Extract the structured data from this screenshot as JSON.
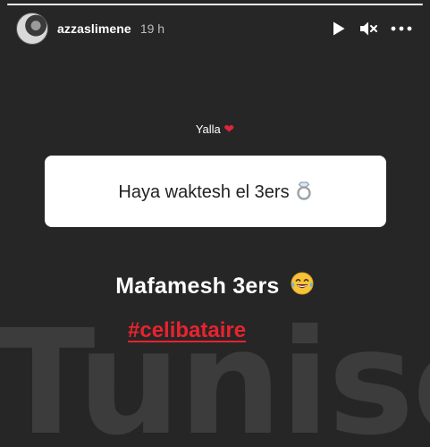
{
  "story": {
    "progress": 1.0
  },
  "header": {
    "username": "azzaslimene",
    "timestamp": "19 h",
    "controls": {
      "play": "play-icon",
      "mute": "muted-speaker-icon",
      "more": "more-horizontal-icon"
    }
  },
  "question": {
    "label": "Yalla",
    "emoji": "❤",
    "answer": "Haya waktesh el 3ers"
  },
  "reply": {
    "text": "Mafamesh 3ers"
  },
  "hashtag": {
    "text": "#celibataire"
  },
  "watermark": {
    "text": "Tunisco"
  },
  "colors": {
    "background": "#262626",
    "card": "#ffffff",
    "hashtag": "#e8232e",
    "heart": "#e0253b"
  }
}
